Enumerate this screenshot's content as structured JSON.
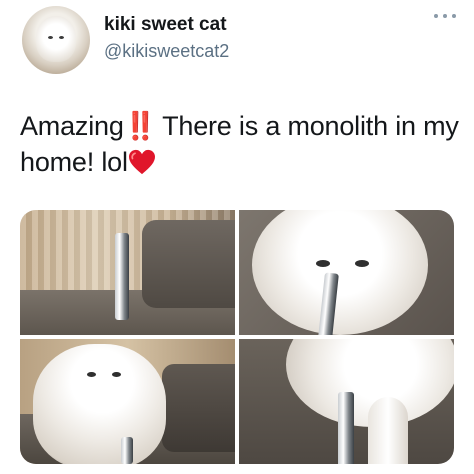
{
  "tweet": {
    "author_name": "kiki sweet cat",
    "author_handle": "@kikisweetcat2",
    "text_part1": "Amazing",
    "emoji_1": "‼️",
    "text_part2": " There is a monolith in my home!  lol",
    "emoji_2": "heart",
    "more_menu_icon": "more-dots-icon"
  },
  "media": {
    "photo_count": 4,
    "photos": [
      {
        "description_icon": "photo"
      },
      {
        "description_icon": "photo"
      },
      {
        "description_icon": "photo"
      },
      {
        "description_icon": "photo"
      }
    ]
  },
  "colors": {
    "text_primary": "#14171a",
    "text_secondary": "#5b7083",
    "heart": "#e0162b"
  }
}
